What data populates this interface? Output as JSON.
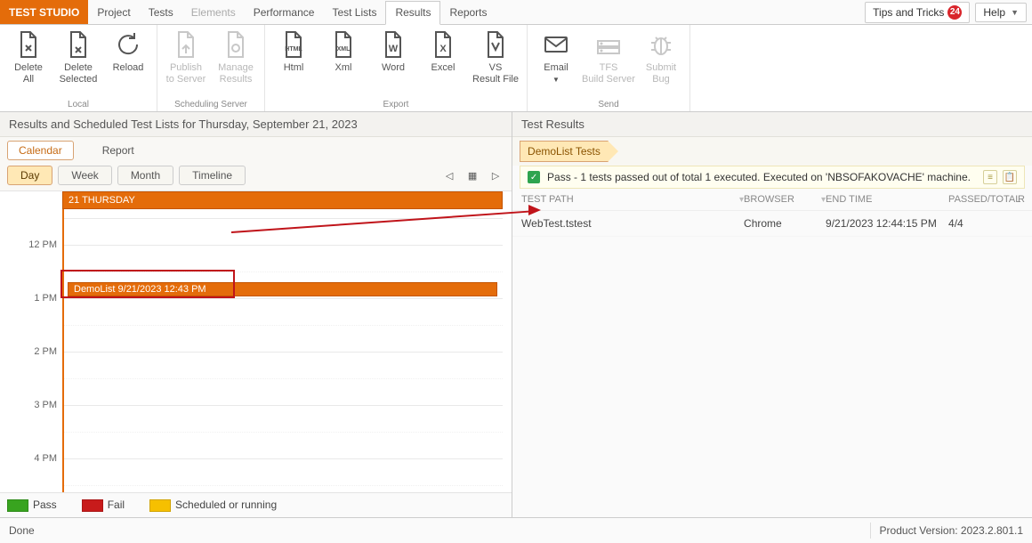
{
  "menubar": {
    "brand": "TEST STUDIO",
    "tabs": [
      "Project",
      "Tests",
      "Elements",
      "Performance",
      "Test Lists",
      "Results",
      "Reports"
    ],
    "active_tab": "Results",
    "disabled_tabs": [
      "Elements"
    ],
    "tips_label": "Tips and Tricks",
    "tips_count": "24",
    "help_label": "Help"
  },
  "ribbon": {
    "groups": [
      {
        "label": "Local",
        "items": [
          {
            "name": "delete-all",
            "label": "Delete\nAll"
          },
          {
            "name": "delete-selected",
            "label": "Delete\nSelected"
          },
          {
            "name": "reload",
            "label": "Reload"
          }
        ]
      },
      {
        "label": "Scheduling Server",
        "items": [
          {
            "name": "publish-to-server",
            "label": "Publish\nto Server",
            "disabled": true
          },
          {
            "name": "manage-results",
            "label": "Manage\nResults",
            "disabled": true
          }
        ]
      },
      {
        "label": "Export",
        "items": [
          {
            "name": "export-html",
            "label": "Html"
          },
          {
            "name": "export-xml",
            "label": "Xml"
          },
          {
            "name": "export-word",
            "label": "Word"
          },
          {
            "name": "export-excel",
            "label": "Excel"
          },
          {
            "name": "export-vs",
            "label": "VS\nResult File"
          }
        ]
      },
      {
        "label": "Send",
        "items": [
          {
            "name": "email",
            "label": "Email",
            "dropdown": true
          },
          {
            "name": "tfs-build-server",
            "label": "TFS\nBuild Server",
            "disabled": true
          },
          {
            "name": "submit-bug",
            "label": "Submit\nBug",
            "disabled": true
          }
        ]
      }
    ]
  },
  "left": {
    "header": "Results and Scheduled Test Lists for Thursday, September 21, 2023",
    "tabs": {
      "calendar": "Calendar",
      "report": "Report"
    },
    "views": {
      "day": "Day",
      "week": "Week",
      "month": "Month",
      "timeline": "Timeline"
    },
    "day_header": "21 THURSDAY",
    "hours": [
      "12 PM",
      "1 PM",
      "2 PM",
      "3 PM",
      "4 PM"
    ],
    "event_label": "DemoList 9/21/2023 12:43 PM",
    "legend": {
      "pass": "Pass",
      "fail": "Fail",
      "sched": "Scheduled or running"
    }
  },
  "right": {
    "header": "Test Results",
    "crumb": "DemoList Tests",
    "status_text": "Pass - 1 tests passed out of total 1 executed. Executed on 'NBSOFAKOVACHE' machine.",
    "columns": {
      "path": "TEST PATH",
      "browser": "BROWSER",
      "end": "END TIME",
      "passed": "PASSED/TOTAL",
      "r": "R"
    },
    "rows": [
      {
        "path": "WebTest.tstest",
        "browser": "Chrome",
        "end": "9/21/2023 12:44:15 PM",
        "passed": "4/4"
      }
    ]
  },
  "status": {
    "done": "Done",
    "version": "Product Version: 2023.2.801.1"
  }
}
